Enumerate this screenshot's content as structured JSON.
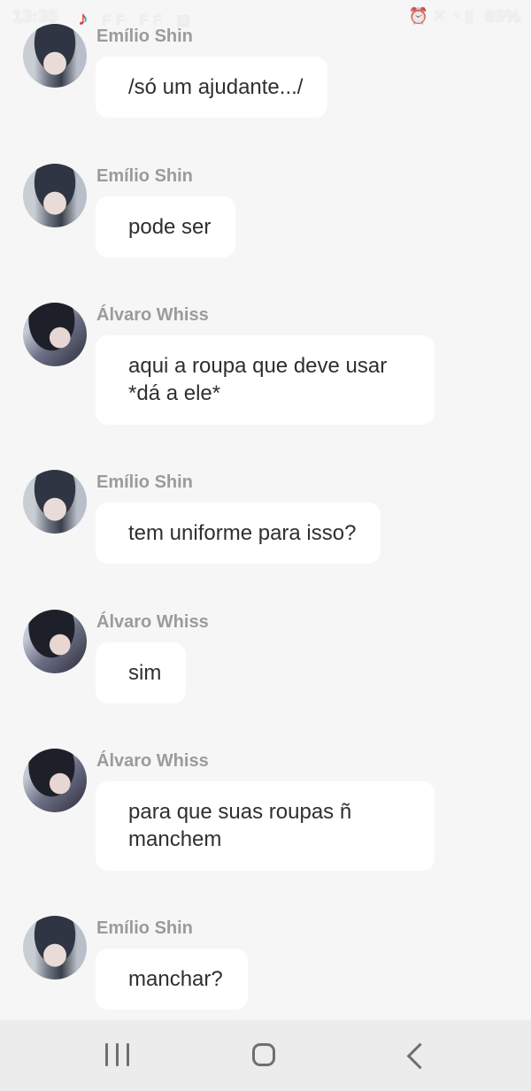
{
  "status_bar": {
    "time": "13:35",
    "app_icons": "FF FF",
    "battery": "89%"
  },
  "messages": [
    {
      "sender": "Emílio Shin",
      "text": "/só um ajudante.../",
      "avatar": "emilio-avatar"
    },
    {
      "sender": "Emílio Shin",
      "text": "pode ser",
      "avatar": "emilio-avatar"
    },
    {
      "sender": "Álvaro Whiss",
      "text_lines": [
        "aqui a roupa que deve usar",
        "*dá a ele*"
      ],
      "avatar": "alvaro-avatar"
    },
    {
      "sender": "Emílio Shin",
      "text": "tem uniforme para isso?",
      "avatar": "emilio-avatar"
    },
    {
      "sender": "Álvaro Whiss",
      "text": "sim",
      "avatar": "alvaro-avatar"
    },
    {
      "sender": "Álvaro Whiss",
      "text_lines": [
        "para que suas roupas ñ",
        "manchem"
      ],
      "avatar": "alvaro-avatar"
    },
    {
      "sender": "Emílio Shin",
      "text": "manchar?",
      "avatar": "emilio-avatar"
    }
  ],
  "nav_bar": {
    "recents": "recents-icon",
    "home": "home-icon",
    "back": "back-icon"
  }
}
